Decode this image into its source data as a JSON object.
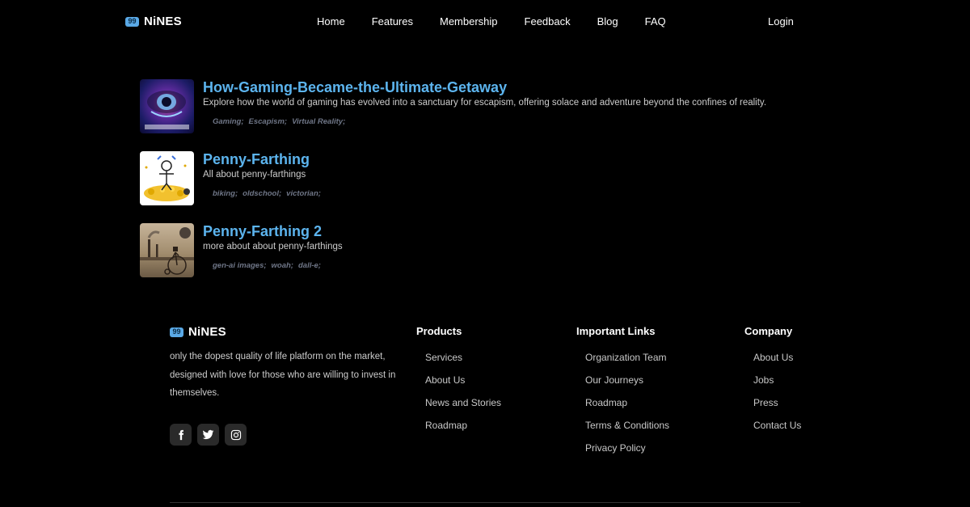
{
  "brand": {
    "logo_glyph": "99",
    "name": "NiNES",
    "accent": "#5aa9e6"
  },
  "nav": {
    "links": [
      "Home",
      "Features",
      "Membership",
      "Feedback",
      "Blog",
      "FAQ"
    ],
    "login": "Login"
  },
  "posts": [
    {
      "title": "How-Gaming-Became-the-Ultimate-Getaway",
      "description": "Explore how the world of gaming has evolved into a sanctuary for escapism, offering solace and adventure beyond the confines of reality.",
      "tags": [
        "Gaming;",
        "Escapism;",
        "Virtual Reality;"
      ]
    },
    {
      "title": "Penny-Farthing",
      "description": "All about penny-farthings",
      "tags": [
        "biking;",
        "oldschool;",
        "victorian;"
      ]
    },
    {
      "title": "Penny-Farthing 2",
      "description": "more about about penny-farthings",
      "tags": [
        "gen-ai images;",
        "woah;",
        "dall-e;"
      ]
    }
  ],
  "footer": {
    "tagline": "only the dopest quality of life platform on the market, designed with love for those who are willing to invest in themselves.",
    "social_icons": [
      "facebook-icon",
      "twitter-icon",
      "instagram-icon"
    ],
    "columns": [
      {
        "heading": "Products",
        "links": [
          "Services",
          "About Us",
          "News and Stories",
          "Roadmap"
        ]
      },
      {
        "heading": "Important Links",
        "links": [
          "Organization Team",
          "Our Journeys",
          "Roadmap",
          "Terms & Conditions",
          "Privacy Policy"
        ]
      },
      {
        "heading": "Company",
        "links": [
          "About Us",
          "Jobs",
          "Press",
          "Contact Us"
        ]
      }
    ]
  }
}
